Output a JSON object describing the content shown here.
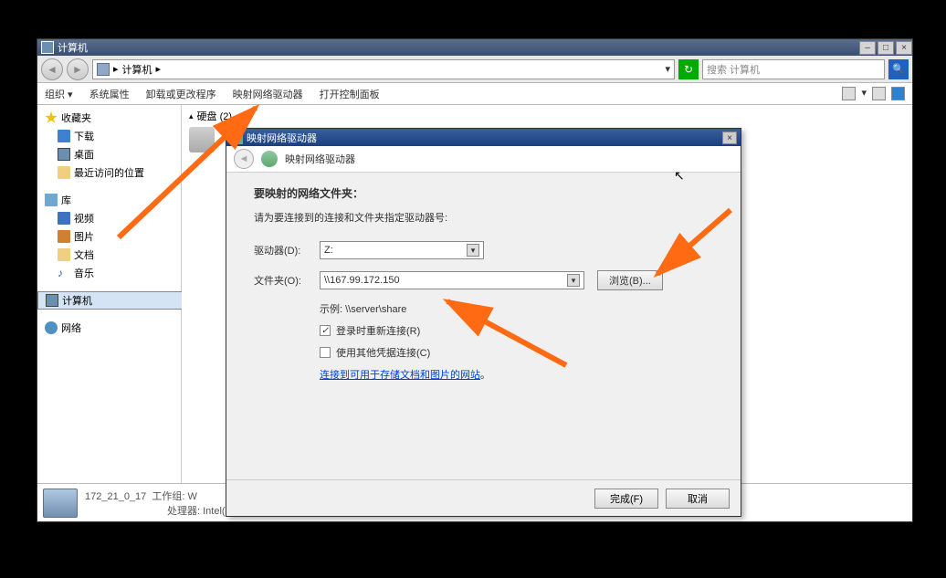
{
  "window": {
    "title": "计算机",
    "address": "计算机",
    "search_placeholder": "搜索 计算机"
  },
  "toolbar": {
    "organize": "组织 ▾",
    "sys_prop": "系统属性",
    "uninstall": "卸载或更改程序",
    "map_drive": "映射网络驱动器",
    "ctrl_panel": "打开控制面板"
  },
  "sidebar": {
    "fav": "收藏夹",
    "downloads": "下载",
    "desktop": "桌面",
    "recent": "最近访问的位置",
    "lib": "库",
    "video": "视频",
    "pictures": "图片",
    "documents": "文档",
    "music": "音乐",
    "computer": "计算机",
    "network": "网络"
  },
  "main_section": "硬盘 (2)",
  "status": {
    "computer": "172_21_0_17",
    "workgroup_label": "工作组:",
    "workgroup": "W",
    "cpu_label": "处理器:",
    "cpu": "Intel(R) Xeon(R) CP..."
  },
  "dialog": {
    "title": "映射网络驱动器",
    "subtitle": "映射网络驱动器",
    "heading": "要映射的网络文件夹：",
    "hint": "请为要连接到的连接和文件夹指定驱动器号:",
    "drive_label": "驱动器(D):",
    "drive_value": "Z:",
    "folder_label": "文件夹(O):",
    "folder_value": "\\\\167.99.172.150",
    "browse": "浏览(B)...",
    "example": "示例: \\\\server\\share",
    "reconnect": "登录时重新连接(R)",
    "other_cred": "使用其他凭据连接(C)",
    "link_pre": "连接到可用于存储文档和图片的网站",
    "link_post": "。",
    "finish": "完成(F)",
    "cancel": "取消"
  }
}
